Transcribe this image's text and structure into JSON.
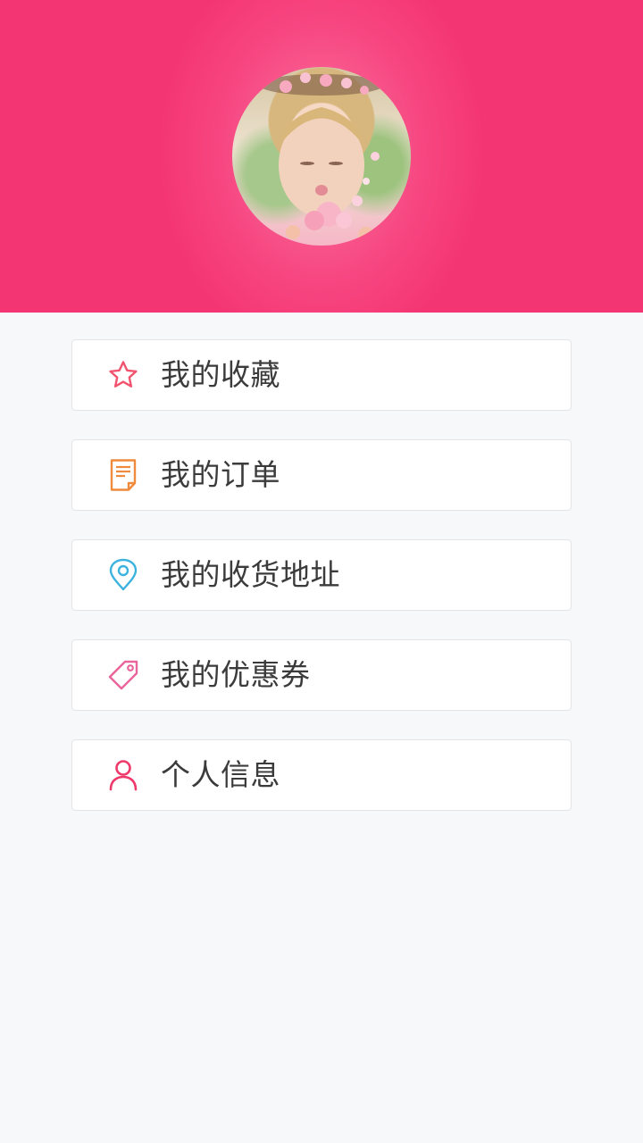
{
  "header": {
    "background_color": "#f43573",
    "avatar_icon": "profile-photo-avatar"
  },
  "menu": {
    "items": [
      {
        "label": "我的收藏",
        "icon": "star-icon",
        "icon_color": "#f2546f"
      },
      {
        "label": "我的订单",
        "icon": "order-document-icon",
        "icon_color": "#f08a3c"
      },
      {
        "label": "我的收货地址",
        "icon": "location-pin-icon",
        "icon_color": "#3cb3de"
      },
      {
        "label": "我的优惠券",
        "icon": "coupon-tag-icon",
        "icon_color": "#e9649a"
      },
      {
        "label": "个人信息",
        "icon": "person-icon",
        "icon_color": "#ee3a6a"
      }
    ]
  }
}
